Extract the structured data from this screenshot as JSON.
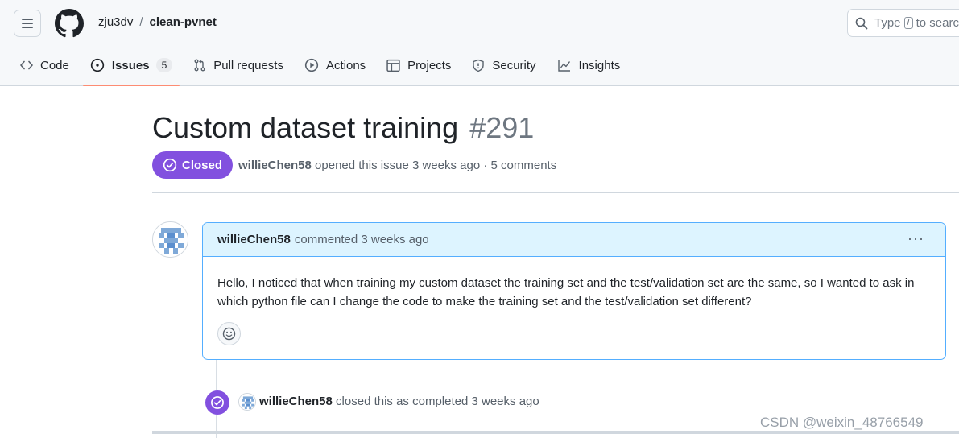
{
  "header": {
    "menu_icon": "hamburger-icon",
    "logo_icon": "github-mark-icon",
    "owner": "zju3dv",
    "separator": "/",
    "repo": "clean-pvnet",
    "search": {
      "prefix": "Type",
      "key": "/",
      "suffix": "to search"
    }
  },
  "tabs": [
    {
      "label": "Code",
      "icon": "code-icon"
    },
    {
      "label": "Issues",
      "icon": "issue-opened-icon",
      "count": "5",
      "selected": true
    },
    {
      "label": "Pull requests",
      "icon": "git-pull-request-icon"
    },
    {
      "label": "Actions",
      "icon": "play-icon"
    },
    {
      "label": "Projects",
      "icon": "table-icon"
    },
    {
      "label": "Security",
      "icon": "shield-icon"
    },
    {
      "label": "Insights",
      "icon": "graph-icon"
    }
  ],
  "issue": {
    "title": "Custom dataset training",
    "number": "#291",
    "state": "Closed",
    "state_color": "#8250df",
    "author": "willieChen58",
    "meta_text": "opened this issue 3 weeks ago · 5 comments"
  },
  "comment": {
    "author": "willieChen58",
    "action": "commented 3 weeks ago",
    "menu_label": "···",
    "body": "Hello, I noticed that when training my custom dataset the training set and the test/validation set are the same, so I wanted to ask in which python file can I change the code to make the training set and the test/validation set different?"
  },
  "event": {
    "author": "willieChen58",
    "text_before": "closed this as",
    "link": "completed",
    "time": "3 weeks ago"
  },
  "watermark": "CSDN @weixin_48766549"
}
